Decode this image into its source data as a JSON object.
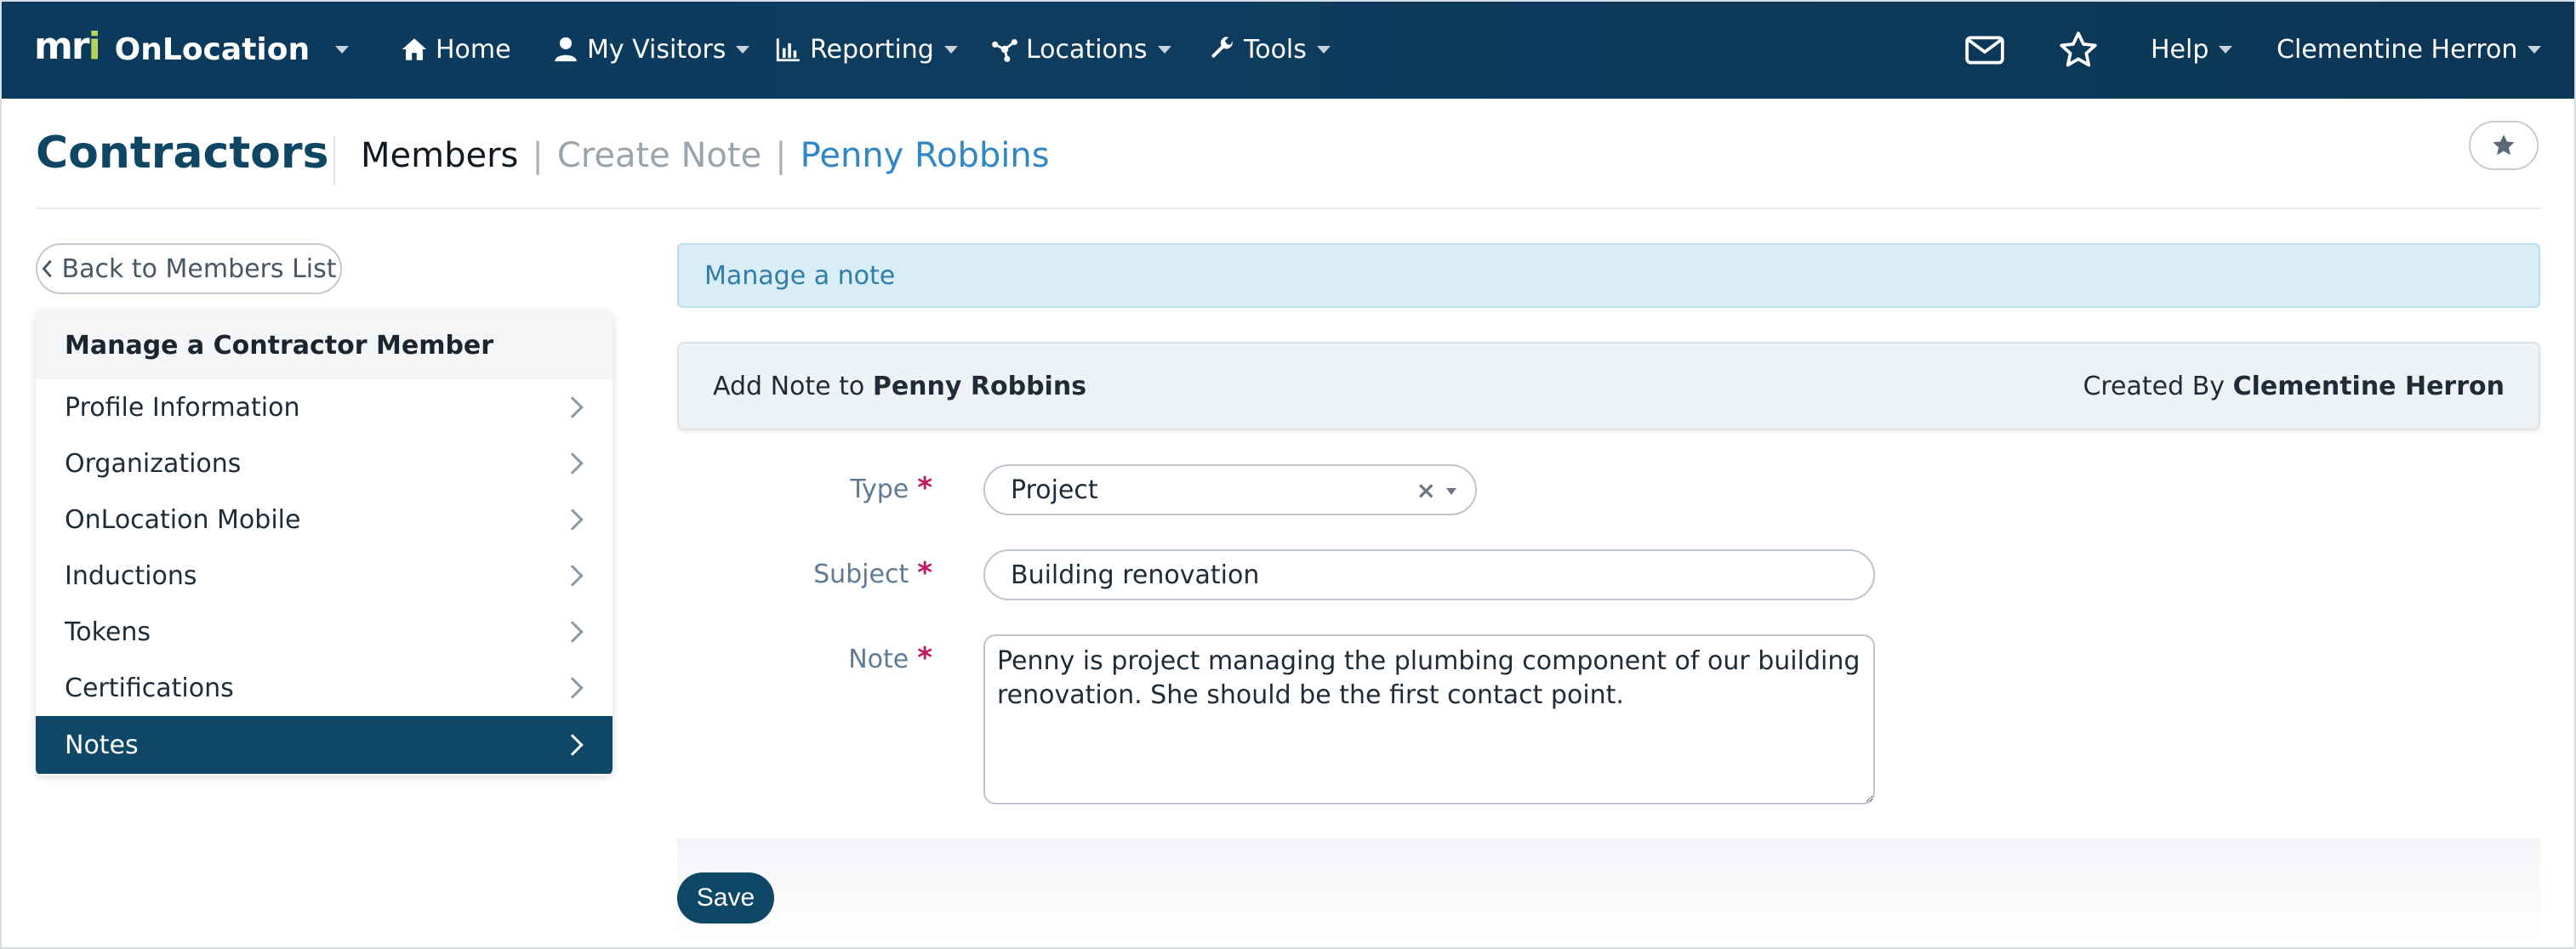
{
  "app": {
    "brand": "mri",
    "name": "OnLocation"
  },
  "topnav": {
    "items": [
      {
        "label": "Home",
        "icon": "home-icon"
      },
      {
        "label": "My Visitors",
        "icon": "user-icon"
      },
      {
        "label": "Reporting",
        "icon": "bar-chart-icon"
      },
      {
        "label": "Locations",
        "icon": "network-icon"
      },
      {
        "label": "Tools",
        "icon": "wrench-icon"
      }
    ],
    "right": {
      "messages_icon": "envelope-icon",
      "favorites_icon": "star-icon",
      "help_label": "Help",
      "user_label": "Clementine Herron"
    }
  },
  "header": {
    "title": "Contractors",
    "breadcrumb": {
      "main": "Members",
      "middle": "Create Note",
      "last": "Penny Robbins",
      "separator": "|"
    }
  },
  "back_button": {
    "label": "Back to Members List"
  },
  "sidebar": {
    "heading": "Manage a Contractor Member",
    "items": [
      {
        "label": "Profile Information",
        "active": false
      },
      {
        "label": "Organizations",
        "active": false
      },
      {
        "label": "OnLocation Mobile",
        "active": false
      },
      {
        "label": "Inductions",
        "active": false
      },
      {
        "label": "Tokens",
        "active": false
      },
      {
        "label": "Certifications",
        "active": false
      },
      {
        "label": "Notes",
        "active": true
      }
    ]
  },
  "main": {
    "alert": "Manage a note",
    "panel": {
      "add_prefix": "Add Note to",
      "member_name": "Penny Robbins",
      "created_prefix": "Created By",
      "created_by": "Clementine Herron"
    },
    "form": {
      "type_label": "Type",
      "type_value": "Project",
      "subject_label": "Subject",
      "subject_value": "Building renovation",
      "note_label": "Note",
      "note_value": "Penny is project managing the plumbing component of our building renovation. She should be the first contact point.",
      "required_mark": "*"
    },
    "save_label": "Save"
  },
  "colors": {
    "nav_bg": "#0c3a5c",
    "title": "#0f4664",
    "link": "#2f87c8",
    "active": "#0e4866",
    "required": "#c2185b",
    "brand_accent": "#b6d45a"
  }
}
